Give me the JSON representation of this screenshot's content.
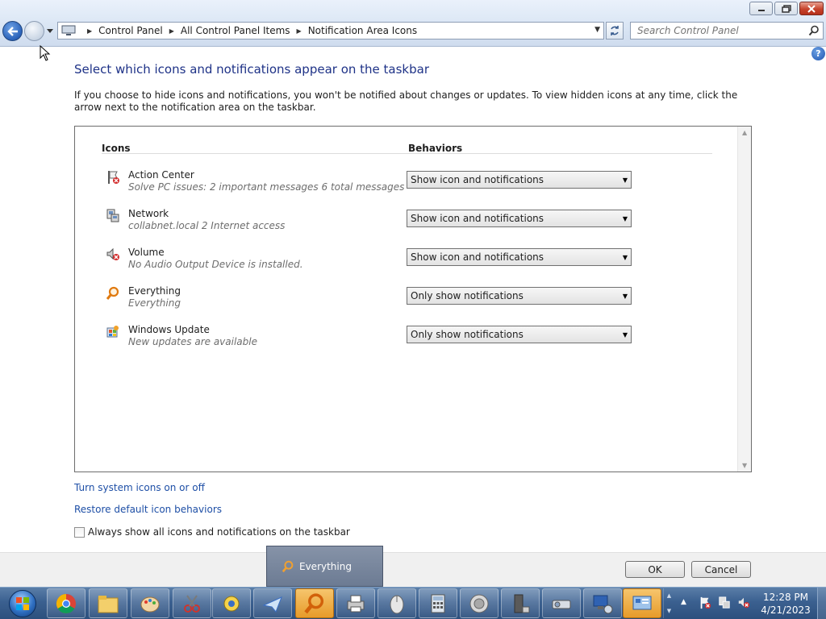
{
  "window": {
    "controls": {
      "minimize": "minimize",
      "maximize": "maximize",
      "close": "close"
    }
  },
  "address": {
    "crumbs": [
      "Control Panel",
      "All Control Panel Items",
      "Notification Area Icons"
    ]
  },
  "search": {
    "placeholder": "Search Control Panel"
  },
  "main": {
    "title": "Select which icons and notifications appear on the taskbar",
    "description": "If you choose to hide icons and notifications, you won't be notified about changes or updates. To view hidden icons at any time, click the arrow next to the notification area on the taskbar.",
    "columns": {
      "icons": "Icons",
      "behaviors": "Behaviors"
    },
    "rows": [
      {
        "name": "Action Center",
        "desc": "Solve PC issues: 2 important messages  6 total messages",
        "behavior": "Show icon and notifications",
        "icon": "action-center-flag-icon"
      },
      {
        "name": "Network",
        "desc": "collabnet.local  2 Internet access",
        "behavior": "Show icon and notifications",
        "icon": "network-icon"
      },
      {
        "name": "Volume",
        "desc": "No Audio Output Device is installed.",
        "behavior": "Show icon and notifications",
        "icon": "volume-muted-icon"
      },
      {
        "name": "Everything",
        "desc": "Everything",
        "behavior": "Only show notifications",
        "icon": "everything-search-icon"
      },
      {
        "name": "Windows Update",
        "desc": "New updates are available",
        "behavior": "Only show notifications",
        "icon": "windows-update-icon"
      }
    ],
    "links": {
      "system_icons": "Turn system icons on or off",
      "restore": "Restore default icon behaviors"
    },
    "checkbox": {
      "label": "Always show all icons and notifications on the taskbar",
      "checked": false
    }
  },
  "footer": {
    "ok": "OK",
    "cancel": "Cancel"
  },
  "preview": {
    "label": "Everything"
  },
  "taskbar": {
    "apps": [
      "chrome-icon",
      "file-explorer-icon",
      "paint-icon",
      "snipping-tool-icon",
      "control-icon",
      "mail-icon",
      "everything-search-icon",
      "printer-icon",
      "mouse-icon",
      "calculator-icon",
      "speaker-icon",
      "server-icon",
      "projector-icon",
      "network-connection-icon",
      "control-panel-icon"
    ],
    "clock": {
      "time": "12:28 PM",
      "date": "4/21/2023"
    }
  },
  "colors": {
    "title": "#1e3287",
    "link": "#1e4fa6",
    "taskbar": "#3b6090"
  }
}
